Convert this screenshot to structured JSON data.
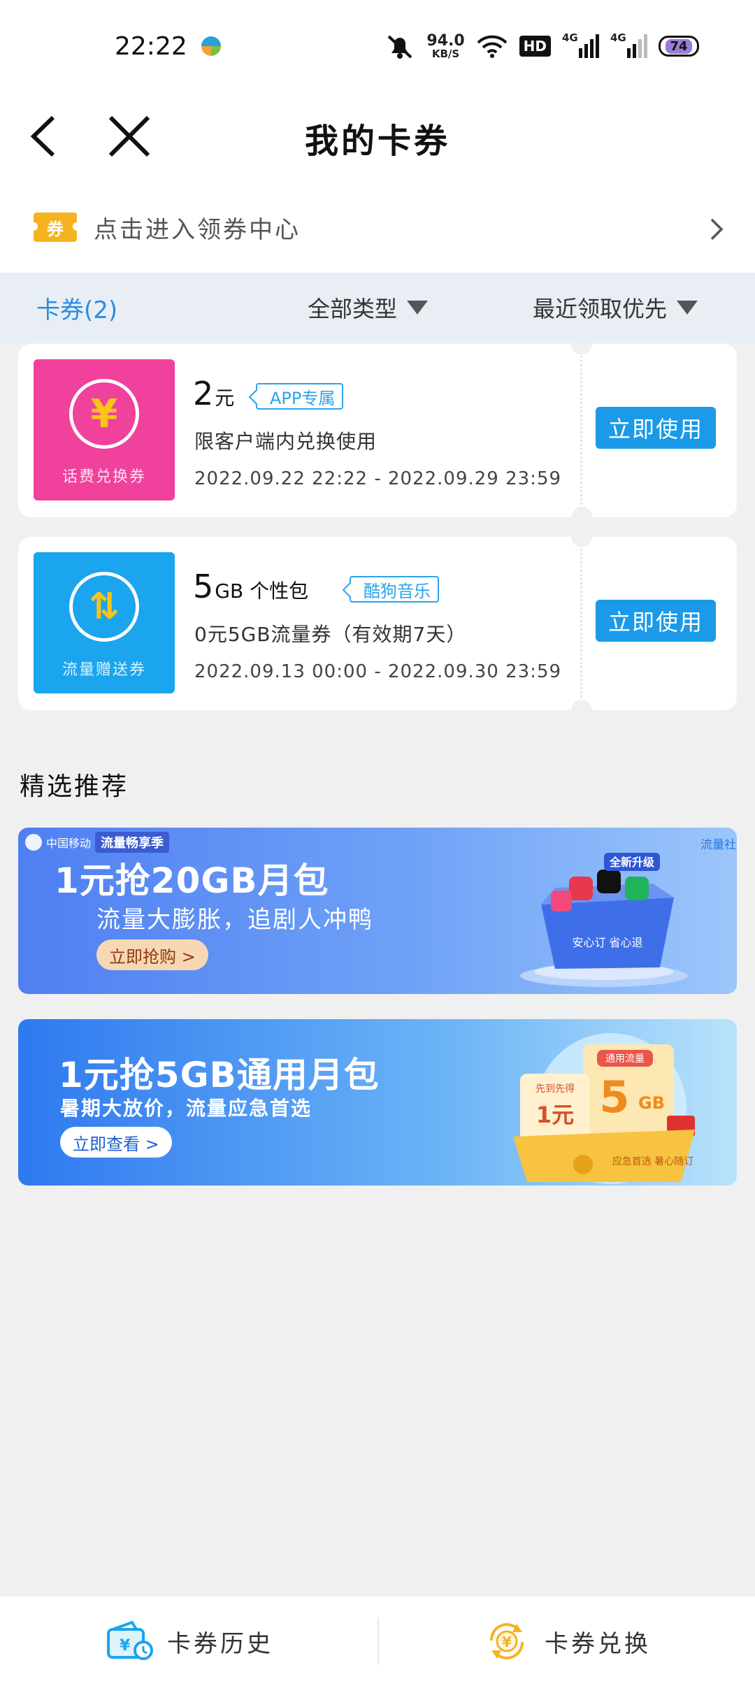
{
  "status": {
    "time": "22:22",
    "speed_value": "94.0",
    "speed_unit": "KB/S",
    "hd": "HD",
    "net1": "4G",
    "net2": "4G",
    "battery": "74"
  },
  "nav": {
    "title": "我的卡券",
    "back_icon": "chevron-left-icon",
    "close_icon": "close-icon"
  },
  "coupon_center": {
    "badge": "券",
    "label": "点击进入领券中心"
  },
  "filters": {
    "count_label": "卡券(2)",
    "type_label": "全部类型",
    "sort_label": "最近领取优先"
  },
  "coupons": [
    {
      "image_tag": "话费兑换券",
      "symbol": "¥",
      "amount": "2",
      "unit": "元",
      "badge": "APP专属",
      "desc": "限客户端内兑换使用",
      "validity": "2022.09.22 22:22 - 2022.09.29 23:59",
      "action": "立即使用",
      "color": "#f0419d"
    },
    {
      "image_tag": "流量赠送券",
      "symbol": "⇅",
      "amount": "5",
      "unit": "GB 个性包",
      "badge": "酷狗音乐",
      "desc": "0元5GB流量券（有效期7天）",
      "validity": "2022.09.13 00:00 - 2022.09.30 23:59",
      "action": "立即使用",
      "color": "#1aa5ee"
    }
  ],
  "recommend": {
    "title": "精选推荐",
    "banners": [
      {
        "brand": "中国移动",
        "pill": "流量畅享季",
        "side": "流量社区",
        "headline": "1元抢20GB月包",
        "sub": "流量大膨胀，追剧人冲鸭",
        "button": "立即抢购 >",
        "box_label": "全新升级",
        "box_text": "安心订 省心退"
      },
      {
        "headline": "1元抢5GB通用月包",
        "sub": "暑期大放价，流量应急首选",
        "button": "立即查看 >",
        "ticket_label": "通用流量",
        "ticket_big": "5",
        "ticket_unit": "GB",
        "ticket_left_top": "先到先得",
        "ticket_left": "1元",
        "box_text": "应急首选 暑心随订"
      }
    ]
  },
  "bottom": {
    "history_label": "卡券历史",
    "exchange_label": "卡券兑换",
    "history_icon": "wallet-clock-icon",
    "exchange_icon": "yen-exchange-icon"
  },
  "colors": {
    "accent": "#1a9ae8",
    "pink": "#f0419d",
    "blue": "#1aa5ee",
    "gold": "#f5b321"
  }
}
